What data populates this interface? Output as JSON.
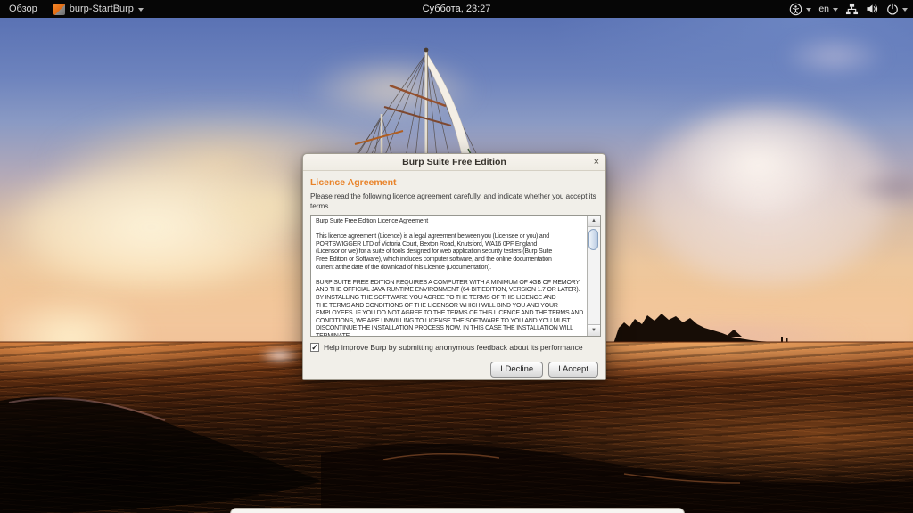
{
  "top_bar": {
    "activities": "Обзор",
    "app_name": "burp-StartBurp",
    "clock": "Суббота, 23:27",
    "keyboard_layout": "en",
    "icons": {
      "app": "burp-icon",
      "accessibility": "accessibility-icon",
      "network": "wired-network-icon",
      "volume": "volume-icon",
      "power": "power-icon"
    }
  },
  "dialog": {
    "title": "Burp Suite Free Edition",
    "close": "×",
    "heading": "Licence Agreement",
    "intro": "Please read the following licence agreement carefully, and indicate whether you accept its terms.",
    "licence_text": "Burp Suite Free Edition Licence Agreement\n\nThis licence agreement (Licence) is a legal agreement between you (Licensee or you) and\nPORTSWIGGER LTD of Victoria Court, Bexton Road, Knutsford, WA16 0PF England\n(Licensor or we) for a suite of tools designed for web application security testers (Burp Suite\nFree Edition or Software), which includes computer software, and the online documentation\ncurrent at the date of the download of this Licence (Documentation).\n\nBURP SUITE FREE EDITION REQUIRES A COMPUTER WITH A MINIMUM OF 4GB OF MEMORY\nAND THE OFFICIAL JAVA RUNTIME ENVIRONMENT (64-BIT EDITION, VERSION 1.7 OR LATER).\nBY INSTALLING THE SOFTWARE YOU AGREE TO THE TERMS OF THIS LICENCE AND\nTHE TERMS AND CONDITIONS OF THE LICENSOR WHICH WILL BIND YOU AND YOUR\nEMPLOYEES. IF YOU DO NOT AGREE TO THE TERMS OF THIS LICENCE AND THE TERMS AND\nCONDITIONS, WE ARE UNWILLING TO LICENSE THE SOFTWARE TO YOU AND YOU MUST\nDISCONTINUE THE INSTALLATION PROCESS NOW. IN THIS CASE THE INSTALLATION WILL\nTERMINATE",
    "scrollbar": {
      "up_glyph": "▲",
      "down_glyph": "▼"
    },
    "checkbox_label": "Help improve Burp by submitting anonymous feedback about its performance",
    "checkbox_checked": true,
    "checkbox_glyph": "✓",
    "buttons": {
      "decline": "I Decline",
      "accept": "I Accept"
    },
    "accent_color": "#e8832a"
  }
}
